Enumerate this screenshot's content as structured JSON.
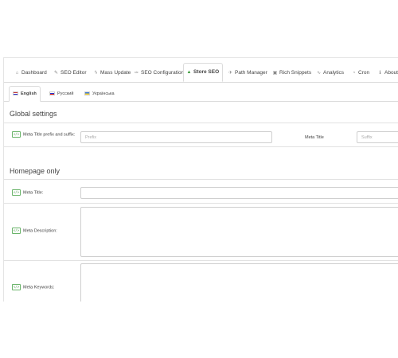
{
  "tabs": [
    {
      "label": "Dashboard",
      "icon": "dashboard-icon",
      "glyph": "⌂"
    },
    {
      "label": "SEO Editor",
      "icon": "edit-icon",
      "glyph": "✎"
    },
    {
      "label": "Mass Update",
      "icon": "flash-icon",
      "glyph": "ϟ"
    },
    {
      "label": "SEO Configuration",
      "icon": "wrench-icon",
      "glyph": "✑"
    },
    {
      "label": "Store SEO",
      "icon": "chart-icon",
      "glyph": "▲"
    },
    {
      "label": "Path Manager",
      "icon": "plane-icon",
      "glyph": "✈"
    },
    {
      "label": "Rich Snippets",
      "icon": "snippets-icon",
      "glyph": "▣"
    },
    {
      "label": "Analytics",
      "icon": "analytics-icon",
      "glyph": "∿"
    },
    {
      "label": "Cron",
      "icon": "cron-icon",
      "glyph": "◔"
    },
    {
      "label": "About",
      "icon": "info-icon",
      "glyph": "ℹ"
    }
  ],
  "active_tab": "Store SEO",
  "languages": [
    {
      "label": "English",
      "flag": "en"
    },
    {
      "label": "Русский",
      "flag": "ru"
    },
    {
      "label": "Українська",
      "flag": "ua"
    }
  ],
  "active_language": "English",
  "global": {
    "title": "Global settings",
    "meta_title_label": "Meta Title prefix and suffix:",
    "prefix_placeholder": "Prefix",
    "meta_title_mid": "Meta Title",
    "suffix_placeholder": "Suffix"
  },
  "homepage": {
    "title": "Homepage only",
    "meta_title_label": "Meta Title:",
    "meta_title_value": "",
    "meta_description_label": "Meta Description:",
    "meta_description_value": "",
    "meta_keywords_label": "Meta Keywords:",
    "meta_keywords_value": ""
  }
}
